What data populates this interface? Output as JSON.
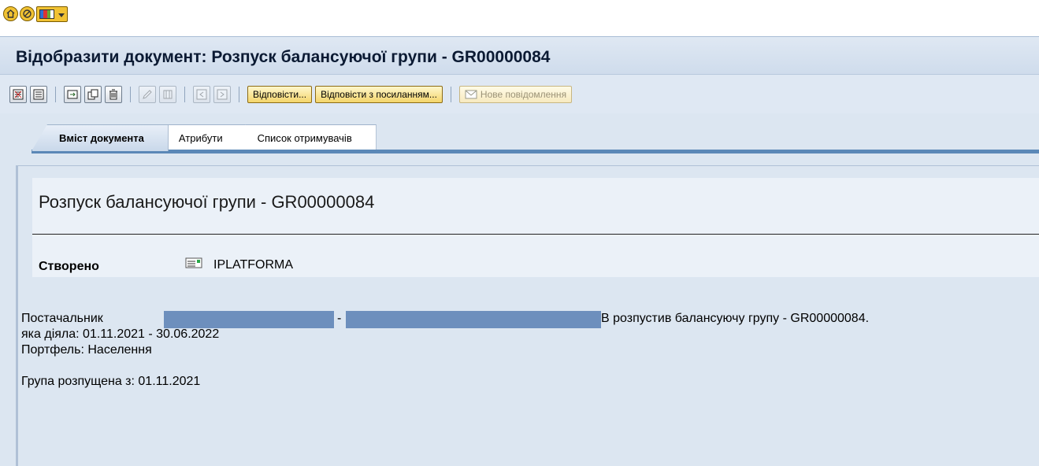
{
  "window": {
    "title": "Відобразити документ: Розпуск балансуючої групи - GR00000084"
  },
  "top_icons": [
    "session-icon",
    "help-icon",
    "layout-icon"
  ],
  "toolbar": {
    "reply_label": "Відповісти...",
    "reply_ref_label": "Відповісти з посиланням...",
    "new_message_label": "Нове повідомлення"
  },
  "tabs": [
    {
      "label": "Вміст документа",
      "active": true
    },
    {
      "label": "Атрибути",
      "active": false
    },
    {
      "label": "Список отримувачів",
      "active": false
    }
  ],
  "document": {
    "heading": "Розпуск балансуючої групи - GR00000084",
    "created_label": "Створено",
    "created_by": "IPLATFORMA",
    "line1_prefix": "Постачальник",
    "line1_dash": "-",
    "line1_suffix": "В розпустив балансуючу групу - GR00000084.",
    "line2": "яка діяла: 01.11.2021 - 30.06.2022",
    "line3": "Портфель: Населення",
    "line4": "Група розпущена з: 01.11.2021"
  },
  "colors": {
    "background": "#dce6f1",
    "redaction": "#6d8fbd",
    "button_gold": "#f4d56b"
  }
}
